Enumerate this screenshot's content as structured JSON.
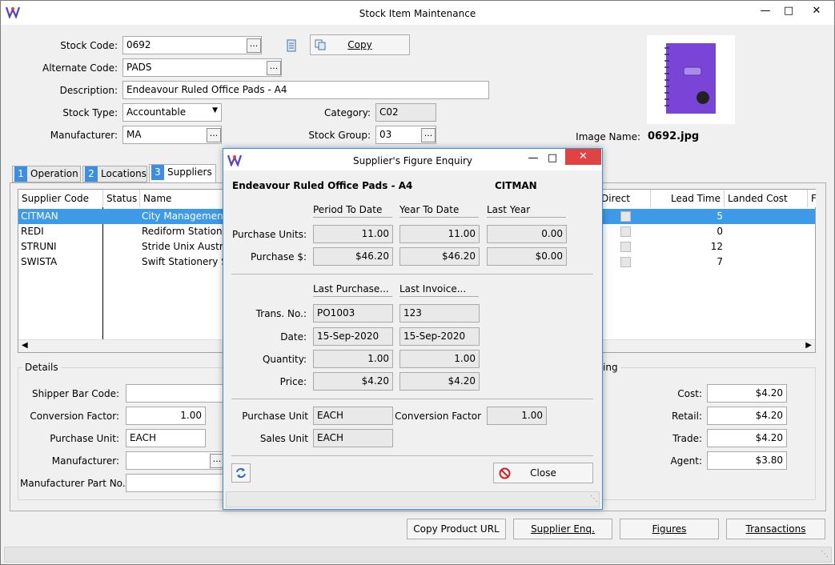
{
  "window": {
    "title": "Stock Item Maintenance"
  },
  "form": {
    "stock_code_label": "Stock Code:",
    "stock_code": "0692",
    "alt_code_label": "Alternate Code:",
    "alt_code": "PADS",
    "description_label": "Description:",
    "description": "Endeavour Ruled Office Pads - A4",
    "stock_type_label": "Stock Type:",
    "stock_type": "Accountable",
    "manufacturer_label": "Manufacturer:",
    "manufacturer": "MA",
    "category_label": "Category:",
    "category": "C02",
    "stock_group_label": "Stock Group:",
    "stock_group": "03",
    "copy_label": "Copy",
    "image_name_label": "Image Name:",
    "image_name": "0692.jpg",
    "dots": "..."
  },
  "tabs": [
    {
      "num": "1",
      "label": "Operation"
    },
    {
      "num": "2",
      "label": "Locations"
    },
    {
      "num": "3",
      "label": "Suppliers"
    }
  ],
  "grid": {
    "headers": [
      "Supplier Code",
      "Status",
      "Name",
      "Direct Ship",
      "Lead Time",
      "Landed Cost Code",
      "F"
    ],
    "rows": [
      {
        "code": "CITMAN",
        "status": "",
        "name": "City Management P",
        "lead": "5"
      },
      {
        "code": "REDI",
        "status": "",
        "name": "Rediform Stationary",
        "lead": "0"
      },
      {
        "code": "STRUNI",
        "status": "",
        "name": "Stride Unix Australia",
        "lead": "12"
      },
      {
        "code": "SWISTA",
        "status": "",
        "name": "Swift Stationery Sup",
        "lead": "7"
      }
    ]
  },
  "details": {
    "title": "Details",
    "shipper_label": "Shipper Bar Code:",
    "shipper": "",
    "conv_label": "Conversion Factor:",
    "conv": "1.00",
    "purch_unit_label": "Purchase Unit:",
    "purch_unit": "EACH",
    "manufacturer_label": "Manufacturer:",
    "manufacturer": "",
    "mpn_label": "Manufacturer Part No.:",
    "mpn": ""
  },
  "pricing": {
    "title": "ing",
    "cost_label": "Cost:",
    "cost": "$4.20",
    "retail_label": "Retail:",
    "retail": "$4.20",
    "trade_label": "Trade:",
    "trade": "$4.20",
    "agent_label": "Agent:",
    "agent": "$3.80"
  },
  "bottom_buttons": {
    "copy_url": "Copy Product URL",
    "supplier_enq": "Supplier Enq.",
    "figures": "Figures",
    "transactions": "Transactions"
  },
  "dialog": {
    "title": "Supplier's Figure Enquiry",
    "item": "Endeavour Ruled Office Pads - A4",
    "supplier": "CITMAN",
    "col_ptd": "Period To Date",
    "col_ytd": "Year To Date",
    "col_ly": "Last Year",
    "purch_units_label": "Purchase Units:",
    "pu_ptd": "11.00",
    "pu_ytd": "11.00",
    "pu_ly": "0.00",
    "purch_amt_label": "Purchase $:",
    "pa_ptd": "$46.20",
    "pa_ytd": "$46.20",
    "pa_ly": "$0.00",
    "col_last_purchase": "Last Purchase...",
    "col_last_invoice": "Last Invoice...",
    "trans_label": "Trans. No.:",
    "trans_p": "PO1003",
    "trans_i": "123",
    "date_label": "Date:",
    "date_p": "15-Sep-2020",
    "date_i": "15-Sep-2020",
    "qty_label": "Quantity:",
    "qty_p": "1.00",
    "qty_i": "1.00",
    "price_label": "Price:",
    "price_p": "$4.20",
    "price_i": "$4.20",
    "pu_label": "Purchase Unit",
    "pu_val": "EACH",
    "cf_label": "Conversion Factor",
    "cf_val": "1.00",
    "su_label": "Sales Unit",
    "su_val": "EACH",
    "close_label": "Close"
  }
}
